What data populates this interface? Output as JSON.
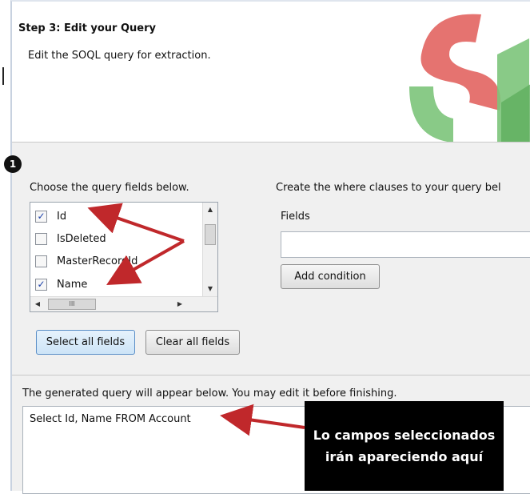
{
  "header": {
    "title": "Step 3: Edit your Query",
    "subtitle": "Edit the SOQL query for extraction."
  },
  "step_badge": "1",
  "fields_section": {
    "label": "Choose the query fields below.",
    "items": [
      {
        "label": "Id",
        "checked": true
      },
      {
        "label": "IsDeleted",
        "checked": false
      },
      {
        "label": "MasterRecordId",
        "checked": false
      },
      {
        "label": "Name",
        "checked": true
      }
    ],
    "hscroll_grip": "III",
    "select_all_label": "Select all fields",
    "clear_all_label": "Clear all fields"
  },
  "where_section": {
    "label": "Create the where clauses to your query bel",
    "fields_label": "Fields",
    "add_condition_label": "Add condition"
  },
  "query_section": {
    "label": "The generated query will appear below.  You may edit it before finishing.",
    "query_text": "Select Id, Name FROM Account"
  },
  "callout": {
    "text": "Lo campos seleccionados irán apareciendo aquí"
  },
  "colors": {
    "arrow": "#c0282b",
    "logo_red": "#e05a57",
    "logo_green": "#7cc47a"
  }
}
